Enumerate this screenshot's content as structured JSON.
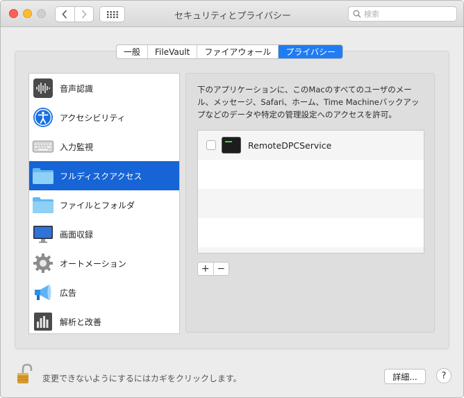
{
  "window": {
    "title": "セキュリティとプライバシー"
  },
  "toolbar": {
    "search_placeholder": "検索",
    "back_icon": "chevron-left-icon",
    "forward_icon": "chevron-right-icon",
    "grid_icon": "show-all-grid-icon"
  },
  "tabs": [
    {
      "label": "一般",
      "active": false
    },
    {
      "label": "FileVault",
      "active": false
    },
    {
      "label": "ファイアウォール",
      "active": false
    },
    {
      "label": "プライバシー",
      "active": true
    }
  ],
  "sidebar": {
    "items": [
      {
        "label": "音声認識",
        "icon": "speech-waveform-icon",
        "selected": false
      },
      {
        "label": "アクセシビリティ",
        "icon": "accessibility-icon",
        "selected": false
      },
      {
        "label": "入力監視",
        "icon": "keyboard-icon",
        "selected": false
      },
      {
        "label": "フルディスクアクセス",
        "icon": "folder-icon",
        "selected": true
      },
      {
        "label": "ファイルとフォルダ",
        "icon": "folder-icon",
        "selected": false
      },
      {
        "label": "画面収録",
        "icon": "display-icon",
        "selected": false
      },
      {
        "label": "オートメーション",
        "icon": "gear-icon",
        "selected": false
      },
      {
        "label": "広告",
        "icon": "megaphone-icon",
        "selected": false
      },
      {
        "label": "解析と改善",
        "icon": "bar-chart-icon",
        "selected": false
      }
    ]
  },
  "main": {
    "description": "下のアプリケーションに、このMacのすべてのユーザのメール、メッセージ、Safari、ホーム、Time Machineバックアップなどのデータや特定の管理設定へのアクセスを許可。",
    "apps": [
      {
        "name": "RemoteDPCService",
        "checked": false,
        "icon": "terminal-icon"
      }
    ],
    "add_label": "+",
    "remove_label": "−"
  },
  "footer": {
    "lock_text": "変更できないようにするにはカギをクリックします。",
    "details_label": "詳細...",
    "help_label": "?"
  },
  "colors": {
    "accent": "#1f7cf3",
    "selection": "#1664d6",
    "close": "#fd5f57",
    "minimize": "#fdbc2e"
  }
}
